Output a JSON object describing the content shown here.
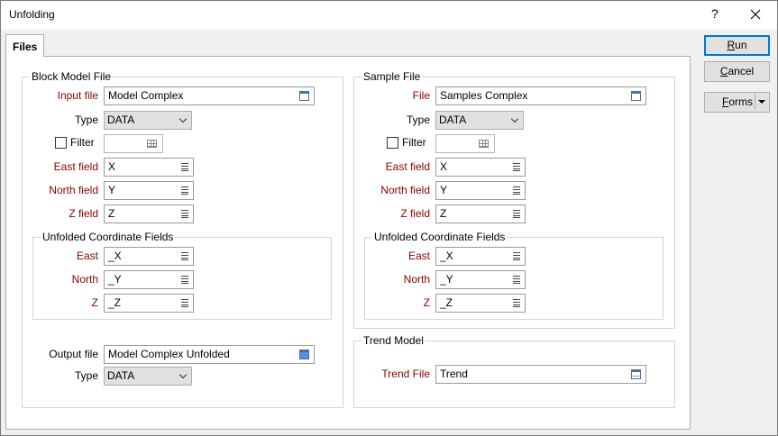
{
  "window": {
    "title": "Unfolding",
    "help_glyph": "?"
  },
  "tabs": [
    {
      "label": "Files"
    }
  ],
  "block_model": {
    "group_label": "Block Model File",
    "input_file_label": "Input file",
    "input_file_value": "Model Complex",
    "type_label": "Type",
    "type_value": "DATA",
    "filter_label": "Filter",
    "east_label": "East field",
    "east_value": "X",
    "north_label": "North field",
    "north_value": "Y",
    "z_label": "Z field",
    "z_value": "Z",
    "unfolded": {
      "group_label": "Unfolded Coordinate Fields",
      "east_label": "East",
      "east_value": "_X",
      "north_label": "North",
      "north_value": "_Y",
      "z_label": "Z",
      "z_value": "_Z"
    },
    "output_file_label": "Output file",
    "output_file_value": "Model Complex Unfolded",
    "output_type_label": "Type",
    "output_type_value": "DATA"
  },
  "sample": {
    "group_label": "Sample File",
    "file_label": "File",
    "file_value": "Samples Complex",
    "type_label": "Type",
    "type_value": "DATA",
    "filter_label": "Filter",
    "east_label": "East field",
    "east_value": "X",
    "north_label": "North field",
    "north_value": "Y",
    "z_label": "Z field",
    "z_value": "Z",
    "unfolded": {
      "group_label": "Unfolded Coordinate Fields",
      "east_label": "East",
      "east_value": "_X",
      "north_label": "North",
      "north_value": "_Y",
      "z_label": "Z",
      "z_value": "_Z"
    }
  },
  "trend": {
    "group_label": "Trend Model",
    "file_label": "Trend File",
    "file_value": "Trend"
  },
  "buttons": {
    "run": {
      "accel": "R",
      "rest": "un"
    },
    "cancel": {
      "accel": "C",
      "rest": "ancel"
    },
    "forms": {
      "accel": "F",
      "rest": "orms"
    }
  },
  "colors": {
    "required_label": "#8b0000",
    "default_button_border": "#0078d7"
  }
}
